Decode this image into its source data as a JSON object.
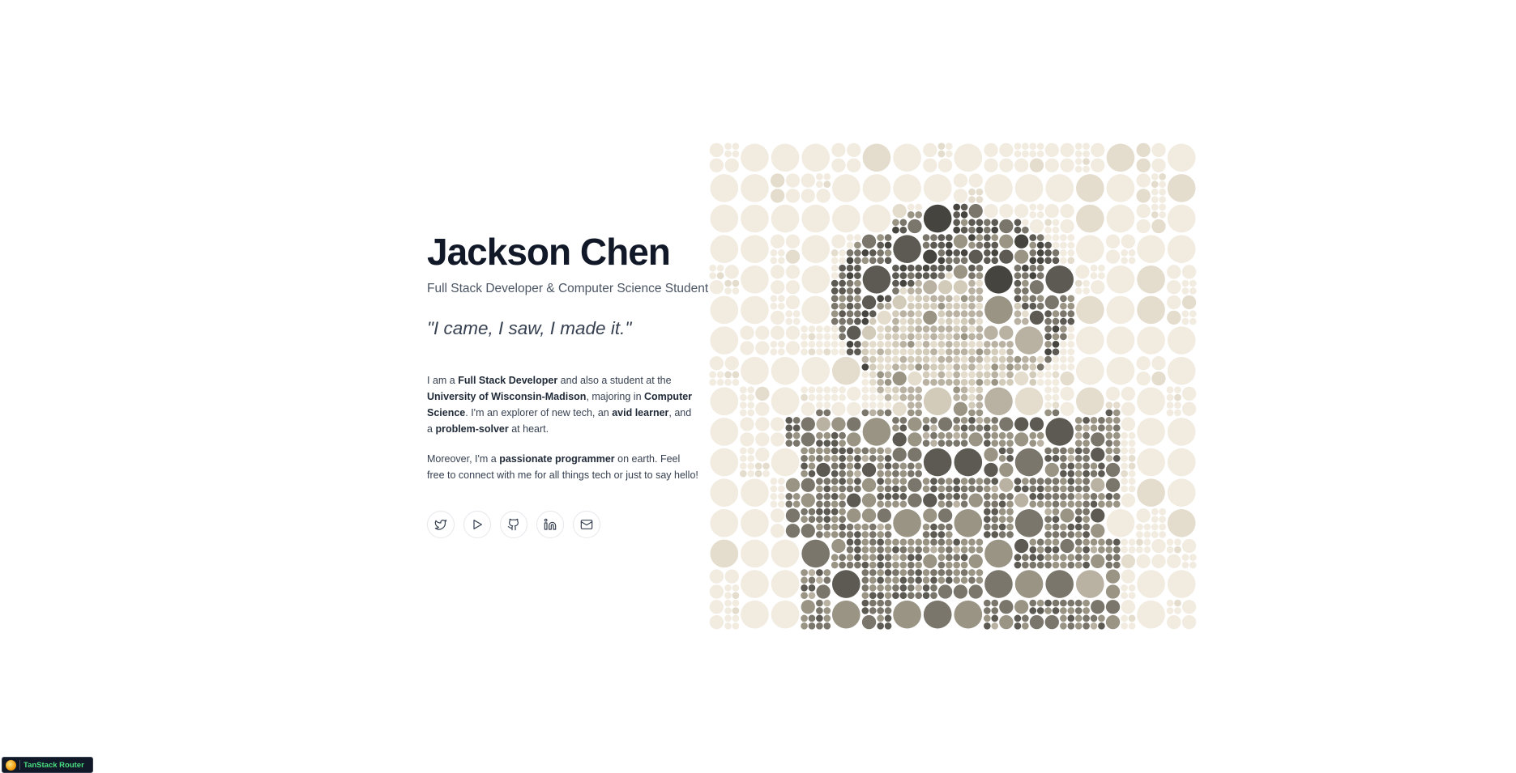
{
  "hero": {
    "name": "Jackson Chen",
    "subtitle": "Full Stack Developer & Computer Science Student",
    "quote": "\"I came, I saw, I made it.\""
  },
  "bio": {
    "p1": {
      "t1": "I am a ",
      "b1": "Full Stack Developer",
      "t2": " and also a student at the ",
      "b2": "University of Wisconsin-Madison",
      "t3": ", majoring in ",
      "b3": "Computer Science",
      "t4": ". I'm an explorer of new tech, an ",
      "b4": "avid learner",
      "t5": ", and a ",
      "b5": "problem-solver",
      "t6": " at heart."
    },
    "p2": {
      "t1": "Moreover, I'm a ",
      "b1": "passionate programmer",
      "t2": " on earth. Feel free to connect with me for all things tech or just to say hello!"
    }
  },
  "socials": [
    {
      "icon": "twitter-icon"
    },
    {
      "icon": "play-icon"
    },
    {
      "icon": "github-icon"
    },
    {
      "icon": "linkedin-icon"
    },
    {
      "icon": "mail-icon"
    }
  ],
  "portrait": {
    "style": "halftone circle-packing portrait",
    "palette": [
      "#f1ebe0",
      "#e4dccc",
      "#d3cbba",
      "#b9b2a3",
      "#9a9485",
      "#7a766b",
      "#5c5a52",
      "#45443e"
    ]
  },
  "devtools": {
    "label": "TanStack Router"
  }
}
